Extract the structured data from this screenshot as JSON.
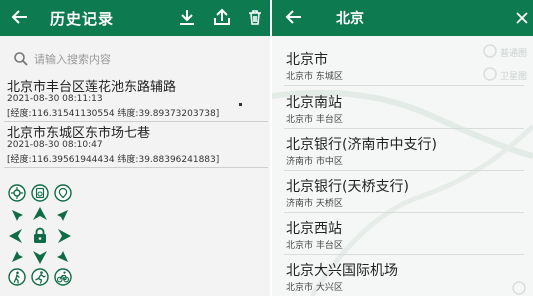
{
  "history": {
    "title": "历史记录",
    "search_placeholder": "请输入搜索内容",
    "records": [
      {
        "address": "北京市丰台区莲花池东路辅路",
        "time": "2021-08-30 08:11:13",
        "coords": "[经度:116.31541130554 纬度:39.89373203738]"
      },
      {
        "address": "北京市东城区东市场七巷",
        "time": "2021-08-30 08:10:47",
        "coords": "[经度:116.39561944434 纬度:39.88396241883]"
      }
    ]
  },
  "search": {
    "query": "北京",
    "map_labels": [
      "普通图",
      "卫星图"
    ],
    "results": [
      {
        "name": "北京市",
        "sub": "北京市 东城区"
      },
      {
        "name": "北京南站",
        "sub": "北京市 丰台区"
      },
      {
        "name": "北京银行(济南市中支行)",
        "sub": "济南市 市中区"
      },
      {
        "name": "北京银行(天桥支行)",
        "sub": "济南市 天桥区"
      },
      {
        "name": "北京西站",
        "sub": "北京市 丰台区"
      },
      {
        "name": "北京大兴国际机场",
        "sub": "北京市 大兴区"
      }
    ]
  },
  "icons": {
    "back": "arrow-left-icon",
    "import": "download-icon",
    "export": "upload-icon",
    "delete": "trash-icon",
    "search": "search-icon",
    "clear": "close-icon",
    "joystick": [
      "gps-icon",
      "history-icon",
      "star-location-icon",
      "arrow-up-left-icon",
      "arrow-up-icon",
      "arrow-up-right-icon",
      "arrow-left-icon",
      "lock-icon",
      "arrow-right-icon",
      "arrow-down-left-icon",
      "arrow-down-icon",
      "arrow-down-right-icon",
      "walk-icon",
      "run-icon",
      "bike-icon"
    ]
  },
  "colors": {
    "primary": "#0e7a4f",
    "joystick": "#0f6b45",
    "divider": "#cfcfcf"
  }
}
